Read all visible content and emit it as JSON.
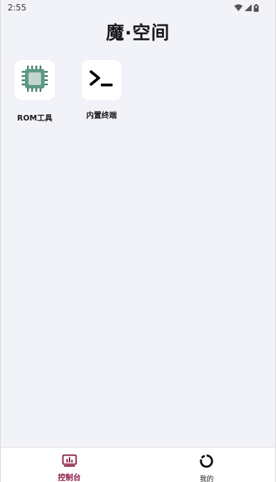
{
  "status_bar": {
    "time": "2:55",
    "icons": [
      "wifi-icon",
      "cell-signal-icon",
      "battery-icon"
    ]
  },
  "header": {
    "title": "魔·空间"
  },
  "apps": [
    {
      "label": "ROM工具",
      "icon": "chip-icon",
      "accent": "#5e9a86"
    },
    {
      "label": "内置终端",
      "icon": "terminal-icon",
      "accent": "#000000"
    }
  ],
  "bottom_nav": {
    "tabs": [
      {
        "label": "控制台",
        "icon": "dashboard-icon",
        "active": true
      },
      {
        "label": "我的",
        "icon": "profile-ring-icon",
        "active": false
      }
    ],
    "active_color": "#8b1c4a"
  },
  "colors": {
    "background": "#f2f3f8",
    "nav_background": "#ffffff"
  }
}
